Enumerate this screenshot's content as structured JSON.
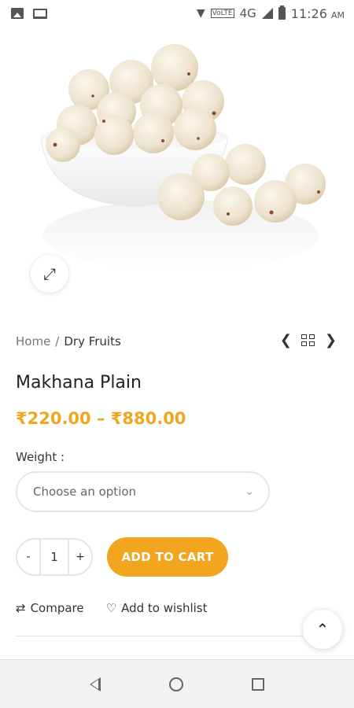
{
  "status_bar": {
    "network": "4G",
    "volte": "VoLTE",
    "time": "11:26",
    "ampm": "AM"
  },
  "product": {
    "image_alt_icon": "expand-icon",
    "breadcrumb": {
      "home": "Home",
      "separator": "/",
      "current": "Dry Fruits"
    },
    "title": "Makhana Plain",
    "price": "₹220.00 – ₹880.00",
    "weight_label": "Weight :",
    "weight_placeholder": "Choose an option",
    "quantity": "1",
    "qty_minus": "-",
    "qty_plus": "+",
    "add_to_cart": "ADD TO CART",
    "compare": "Compare",
    "wishlist": "Add to wishlist"
  },
  "colors": {
    "accent": "#f2a51f"
  },
  "icons": [
    "expand-icon",
    "chevron-left-icon",
    "grid-icon",
    "chevron-right-icon",
    "chevron-down-icon",
    "shuffle-icon",
    "heart-icon",
    "chevron-up-icon",
    "back-icon",
    "home-icon",
    "recents-icon"
  ]
}
